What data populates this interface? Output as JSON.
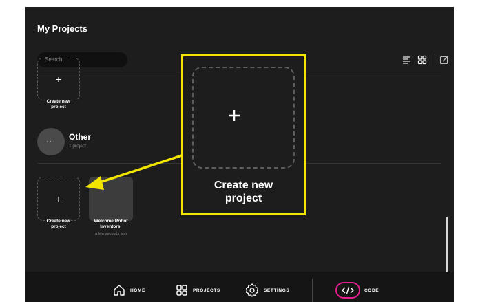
{
  "page": {
    "title": "My Projects",
    "search_placeholder": "Search"
  },
  "toolbar": {
    "icons": [
      "list-view-icon",
      "grid-view-icon",
      "edit-icon"
    ]
  },
  "sections": {
    "top_card": {
      "plus": "+",
      "label": "Create new\nproject"
    },
    "other_group": {
      "avatar": "···",
      "title": "Other",
      "count": "1 project"
    },
    "create_card": {
      "plus": "+",
      "label": "Create new\nproject"
    },
    "project_card": {
      "label": "Welcome Robot\nInventors!",
      "time": "a few seconds ago"
    }
  },
  "callout": {
    "label": "Create new\nproject",
    "border_color": "#f2e600"
  },
  "nav": {
    "items": [
      {
        "label": "HOME",
        "icon": "home-icon"
      },
      {
        "label": "PROJECTS",
        "icon": "projects-icon"
      },
      {
        "label": "SETTINGS",
        "icon": "settings-icon"
      },
      {
        "label": "CODE",
        "icon": "code-icon"
      }
    ],
    "code_accent": "#e41e8e"
  }
}
